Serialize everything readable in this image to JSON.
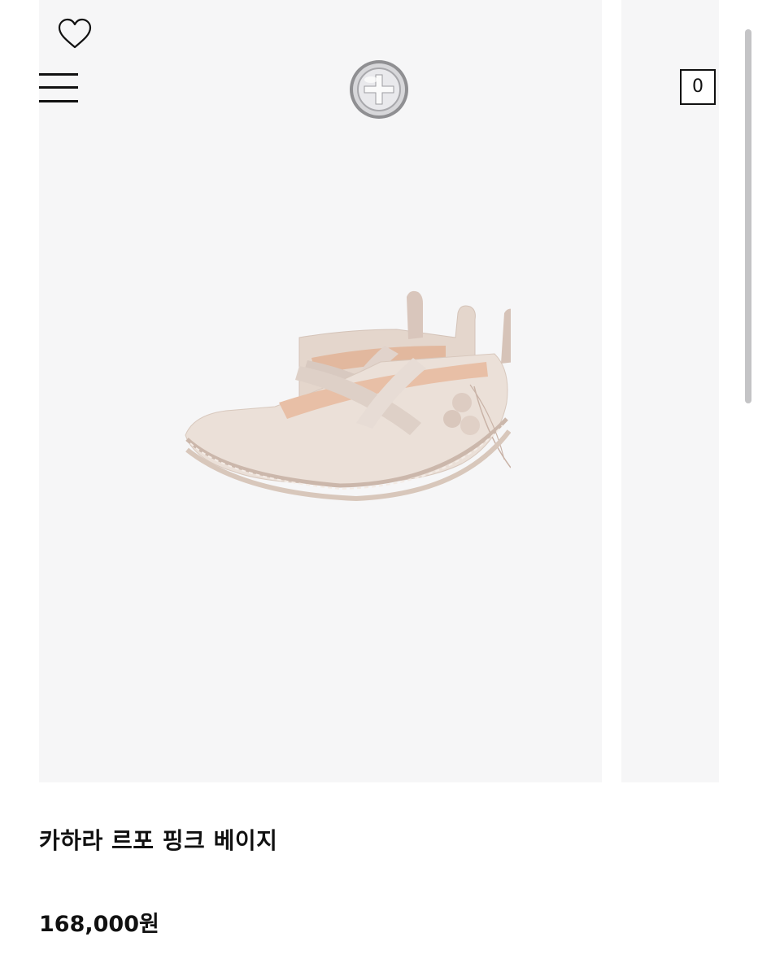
{
  "header": {
    "wishlist_icon": "heart-outline-icon",
    "menu_icon": "hamburger-menu-icon",
    "logo_icon": "silver-seal-cross-logo",
    "cart_count": "0"
  },
  "product": {
    "title": "카하라 르포 핑크 베이지",
    "price": "168,000원",
    "image_icon": "beige-mary-jane-shoes"
  },
  "colors": {
    "image_background": "#f6f6f7",
    "shoe_leather": "#e6d8cf",
    "text": "#111111"
  }
}
